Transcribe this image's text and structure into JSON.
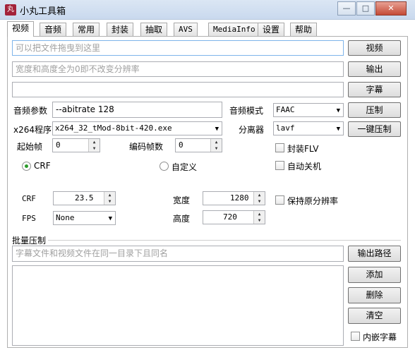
{
  "window": {
    "app_icon": "丸",
    "title": "小丸工具箱",
    "minimize": "—",
    "maximize": "□",
    "close": "✕"
  },
  "tabs": [
    "视频",
    "音频",
    "常用",
    "封装",
    "抽取",
    "AVS",
    "MediaInfo",
    "设置",
    "帮助"
  ],
  "video": {
    "drop_placeholder": "可以把文件拖曳到这里",
    "video_button": "视频",
    "size_placeholder": "宽度和高度全为0即不改变分辨率",
    "output_button": "输出",
    "subtitle_button": "字幕",
    "audio_params_label": "音频参数",
    "audio_params_value": "--abitrate 128",
    "audio_mode_label": "音频模式",
    "audio_mode_value": "FAAC",
    "compress_button": "压制",
    "x264_label": "x264程序",
    "x264_value": "x264_32_tMod-8bit-420.exe",
    "splitter_label": "分离器",
    "splitter_value": "lavf",
    "one_click_button": "一键压制",
    "start_frame_label": "起始帧",
    "start_frame_value": "0",
    "encode_frames_label": "编码帧数",
    "encode_frames_value": "0",
    "mux_flv_label": "封装FLV",
    "auto_shutdown_label": "自动关机",
    "crf_radio_label": "CRF",
    "custom_radio_label": "自定义",
    "crf_label": "CRF",
    "crf_value": "23.5",
    "width_label": "宽度",
    "width_value": "1280",
    "keep_res_label": "保持原分辨率",
    "fps_label": "FPS",
    "fps_value": "None",
    "height_label": "高度",
    "height_value": "720"
  },
  "batch": {
    "group_label": "批量压制",
    "placeholder": "字幕文件和视频文件在同一目录下且同名",
    "output_path_button": "输出路径",
    "add_button": "添加",
    "delete_button": "删除",
    "clear_button": "清空",
    "embed_subtitle_label": "内嵌字幕"
  }
}
